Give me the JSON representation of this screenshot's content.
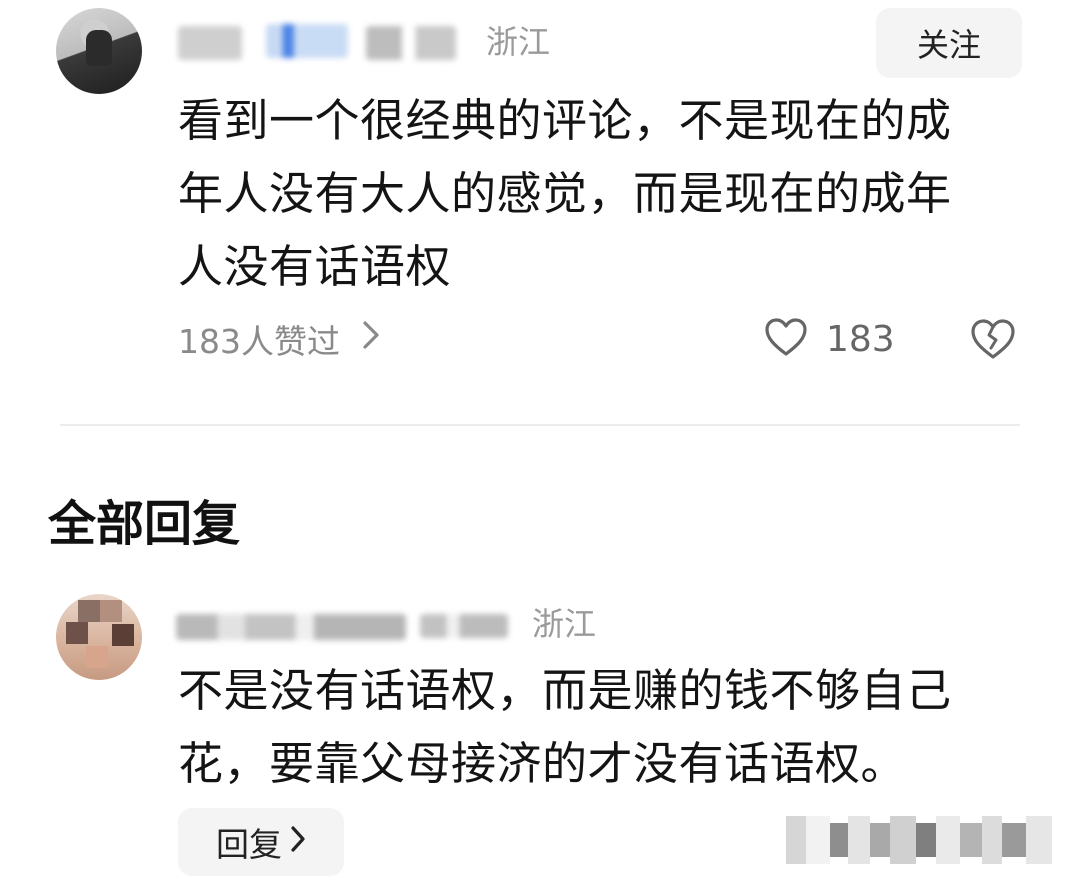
{
  "main_comment": {
    "location": "浙江",
    "follow_label": "关注",
    "text_lines": [
      "看到一个很经典的评论，不是现在的成",
      "年人没有大人的感觉，而是现在的成年",
      "人没有话语权"
    ],
    "likes_summary": "183人赞过",
    "like_count": "183"
  },
  "section_title": "全部回复",
  "reply": {
    "location": "浙江",
    "text_lines": [
      "不是没有话语权，而是赚的钱不够自己",
      "花，要靠父母接济的才没有话语权。"
    ],
    "reply_label": "回复"
  },
  "icons": {
    "like": "heart-outline-icon",
    "dislike": "broken-heart-icon",
    "chevron": "chevron-right-icon"
  },
  "colors": {
    "text": "#141414",
    "muted": "#8a8a8a",
    "button_bg": "#f4f4f4",
    "divider": "#ececec"
  }
}
